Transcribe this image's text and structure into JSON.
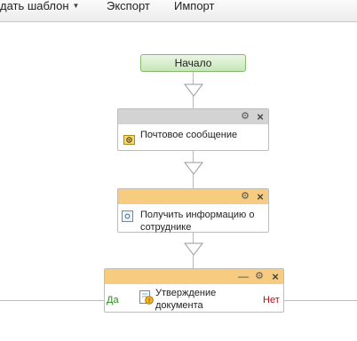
{
  "menu": {
    "create_template_label": "дать шаблон",
    "export_label": "Экспорт",
    "import_label": "Импорт"
  },
  "workflow": {
    "start_label": "Начало",
    "nodes": [
      {
        "label": "Почтовое сообщение",
        "icon": "email-icon",
        "header_color": "#d3d3d3"
      },
      {
        "label": "Получить информацию о\nсотруднике",
        "icon": "task-icon",
        "header_color": "#f7cb80"
      },
      {
        "label": "Утверждение\nдокумента",
        "icon": "approval-icon",
        "header_color": "#f7cb80"
      }
    ],
    "branch_yes": "Да",
    "branch_no": "Нет"
  },
  "colors": {
    "start_fill": "#c7e5b8",
    "start_border": "#87b971",
    "header_gray": "#d3d3d3",
    "header_orange": "#f7cb80",
    "yes_text": "#2f8a20",
    "no_text": "#b01010"
  }
}
